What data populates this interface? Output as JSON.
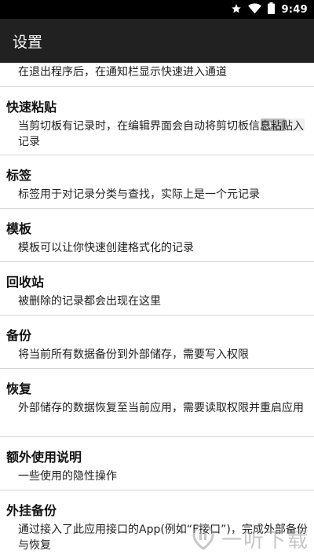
{
  "status_bar": {
    "time": "9:49",
    "icons": [
      "star-icon",
      "wifi-icon",
      "battery-icon"
    ]
  },
  "app_bar": {
    "title": "设置"
  },
  "settings": {
    "partial_top_description": "在退出程序后，在通知栏显示快速进入通道",
    "items": [
      {
        "title": "快速粘贴",
        "description": "当剪切板有记录时，在编辑界面会自动将剪切板信息粘贴入记录",
        "toggle": "OFF"
      },
      {
        "title": "标签",
        "description": "标签用于对记录分类与查找，实际上是一个元记录"
      },
      {
        "title": "模板",
        "description": "模板可以让你快速创建格式化的记录"
      },
      {
        "title": "回收站",
        "description": "被删除的记录都会出现在这里"
      },
      {
        "title": "备份",
        "description": "将当前所有数据备份到外部储存，需要写入权限"
      },
      {
        "title": "恢复",
        "description": "外部储存的数据恢复至当前应用，需要读取权限并重启应用"
      },
      {
        "title": "额外使用说明",
        "description": "一些使用的隐性操作"
      },
      {
        "title": "外挂备份",
        "description": "通过接入了此应用接口的App(例如“F接口”)，完成外部备份与恢复"
      }
    ]
  },
  "watermark": {
    "text": "一听下载",
    "logo_icon": "yiting-logo-icon"
  },
  "colors": {
    "status_bar": "#000000",
    "app_bar": "#212121",
    "divider": "#d6d6d6",
    "toggle_off": "#b8b8b8"
  }
}
